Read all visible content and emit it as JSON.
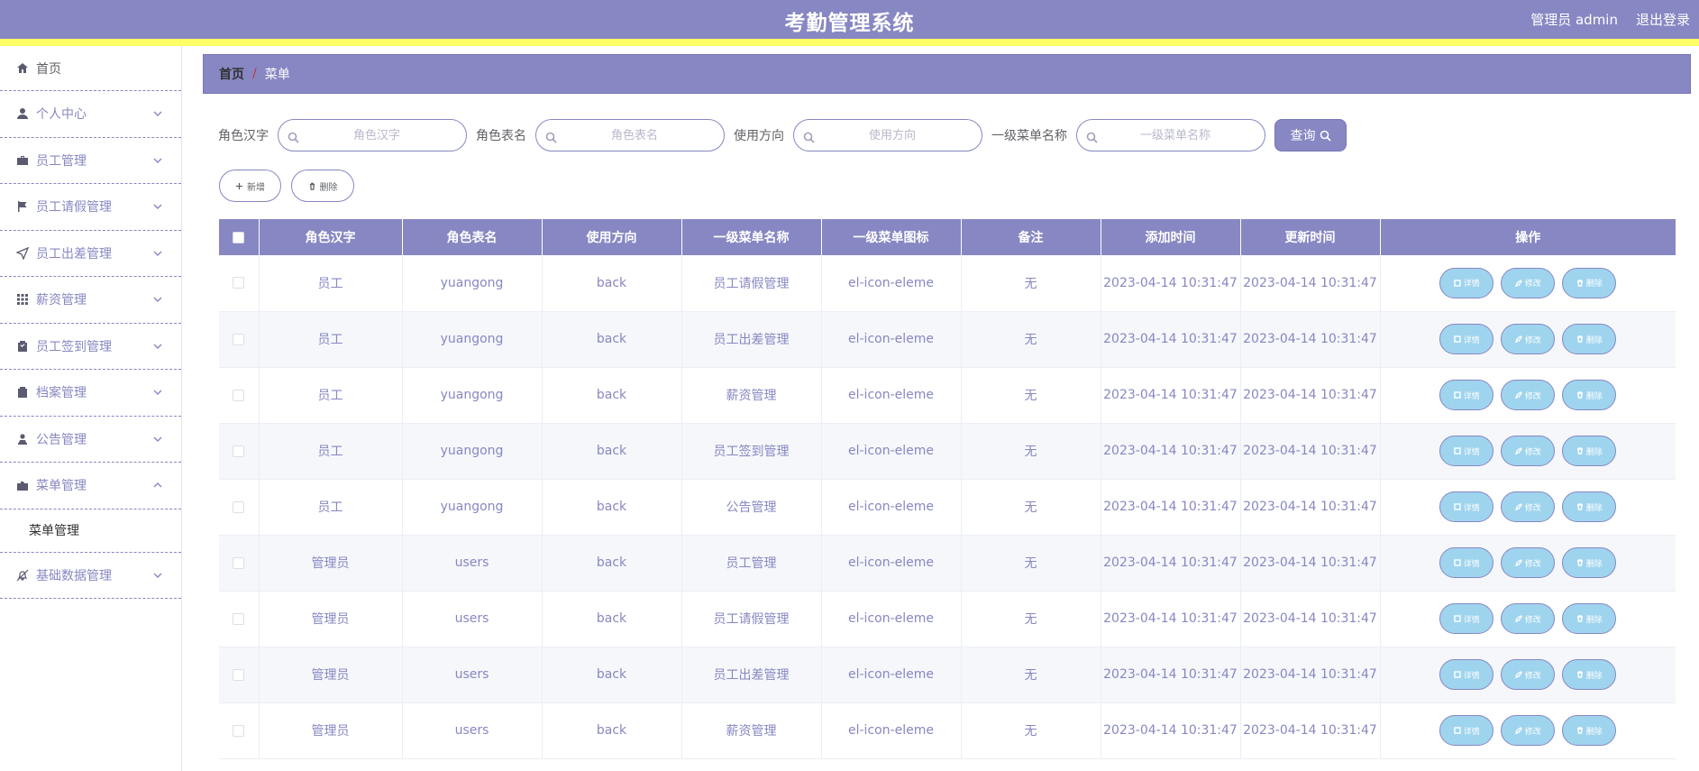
{
  "header": {
    "title": "考勤管理系统",
    "user": "管理员 admin",
    "logout": "退出登录"
  },
  "sidebar": {
    "items": [
      {
        "label": "首页",
        "icon": "home-icon",
        "expandable": false
      },
      {
        "label": "个人中心",
        "icon": "user-icon",
        "expandable": true
      },
      {
        "label": "员工管理",
        "icon": "briefcase-icon",
        "expandable": true
      },
      {
        "label": "员工请假管理",
        "icon": "flag-icon",
        "expandable": true
      },
      {
        "label": "员工出差管理",
        "icon": "send-icon",
        "expandable": true
      },
      {
        "label": "薪资管理",
        "icon": "grid-icon",
        "expandable": true
      },
      {
        "label": "员工签到管理",
        "icon": "checklist-icon",
        "expandable": true
      },
      {
        "label": "档案管理",
        "icon": "clipboard-icon",
        "expandable": true
      },
      {
        "label": "公告管理",
        "icon": "person-stamp-icon",
        "expandable": true
      },
      {
        "label": "菜单管理",
        "icon": "folder-icon",
        "expandable": true,
        "expanded": true
      },
      {
        "label": "基础数据管理",
        "icon": "bell-off-icon",
        "expandable": true
      }
    ],
    "submenu": {
      "label": "菜单管理"
    }
  },
  "breadcrumb": {
    "home": "首页",
    "separator": "/",
    "current": "菜单"
  },
  "search": {
    "fields": [
      {
        "label": "角色汉字",
        "placeholder": "角色汉字"
      },
      {
        "label": "角色表名",
        "placeholder": "角色表名"
      },
      {
        "label": "使用方向",
        "placeholder": "使用方向"
      },
      {
        "label": "一级菜单名称",
        "placeholder": "一级菜单名称"
      }
    ],
    "query_label": "查询"
  },
  "actions": {
    "add_label": "新增",
    "delete_label": "删除"
  },
  "table": {
    "columns": [
      "角色汉字",
      "角色表名",
      "使用方向",
      "一级菜单名称",
      "一级菜单图标",
      "备注",
      "添加时间",
      "更新时间",
      "操作"
    ],
    "op_labels": {
      "detail": "详情",
      "edit": "修改",
      "delete": "删除"
    },
    "rows": [
      [
        "员工",
        "yuangong",
        "back",
        "员工请假管理",
        "el-icon-eleme",
        "无",
        "2023-04-14 10:31:47",
        "2023-04-14 10:31:47"
      ],
      [
        "员工",
        "yuangong",
        "back",
        "员工出差管理",
        "el-icon-eleme",
        "无",
        "2023-04-14 10:31:47",
        "2023-04-14 10:31:47"
      ],
      [
        "员工",
        "yuangong",
        "back",
        "薪资管理",
        "el-icon-eleme",
        "无",
        "2023-04-14 10:31:47",
        "2023-04-14 10:31:47"
      ],
      [
        "员工",
        "yuangong",
        "back",
        "员工签到管理",
        "el-icon-eleme",
        "无",
        "2023-04-14 10:31:47",
        "2023-04-14 10:31:47"
      ],
      [
        "员工",
        "yuangong",
        "back",
        "公告管理",
        "el-icon-eleme",
        "无",
        "2023-04-14 10:31:47",
        "2023-04-14 10:31:47"
      ],
      [
        "管理员",
        "users",
        "back",
        "员工管理",
        "el-icon-eleme",
        "无",
        "2023-04-14 10:31:47",
        "2023-04-14 10:31:47"
      ],
      [
        "管理员",
        "users",
        "back",
        "员工请假管理",
        "el-icon-eleme",
        "无",
        "2023-04-14 10:31:47",
        "2023-04-14 10:31:47"
      ],
      [
        "管理员",
        "users",
        "back",
        "员工出差管理",
        "el-icon-eleme",
        "无",
        "2023-04-14 10:31:47",
        "2023-04-14 10:31:47"
      ],
      [
        "管理员",
        "users",
        "back",
        "薪资管理",
        "el-icon-eleme",
        "无",
        "2023-04-14 10:31:47",
        "2023-04-14 10:31:47"
      ]
    ]
  },
  "colors": {
    "primary": "#8787c3",
    "accent_strip": "#ffff66",
    "op_button": "#9fd4ee"
  }
}
